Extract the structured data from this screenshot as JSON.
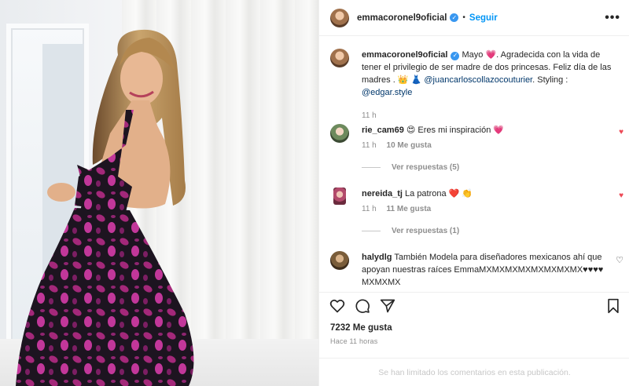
{
  "post": {
    "username": "emmacoronel9oficial",
    "verified_mark": "✓",
    "separator": "•",
    "follow_label": "Seguir",
    "more_label": "•••"
  },
  "caption": {
    "username": "emmacoronel9oficial",
    "text_1": " Mayo ",
    "emoji_1": "💗",
    "text_2": ". Agradecida con la vida de tener el privilegio de ser madre de dos princesas. Feliz día de las madres . ",
    "emoji_2": "👑 👗",
    "mention_1": "@juancarloscollazocouturier",
    "text_3": ". Styling : ",
    "mention_2": "@edgar.style",
    "time": "11 h"
  },
  "comments": [
    {
      "username": "rie_cam69",
      "text": " 😍 Eres mi inspiración 💗",
      "time": "11 h",
      "likes": "10 Me gusta",
      "replies": "Ver respuestas (5)",
      "heart": "♥"
    },
    {
      "username": "nereida_tj",
      "text": " La patrona ❤️ 👏",
      "time": "11 h",
      "likes": "11 Me gusta",
      "replies": "Ver respuestas (1)",
      "heart": "♥"
    },
    {
      "username": "halydlg",
      "text": " También Modela para diseñadores mexicanos ahí que apoyan nuestras raíces EmmaMXMXMXMXMXMXMXMX♥♥♥♥MXMXMX",
      "heart": "♡"
    }
  ],
  "footer": {
    "likes_count": "7232 Me gusta",
    "time_ago": "Hace 11 horas",
    "comments_limited": "Se han limitado los comentarios en esta publicación."
  },
  "colors": {
    "accent": "#0095f6",
    "heart": "#ed4956",
    "dress_magenta": "#a4287a"
  }
}
